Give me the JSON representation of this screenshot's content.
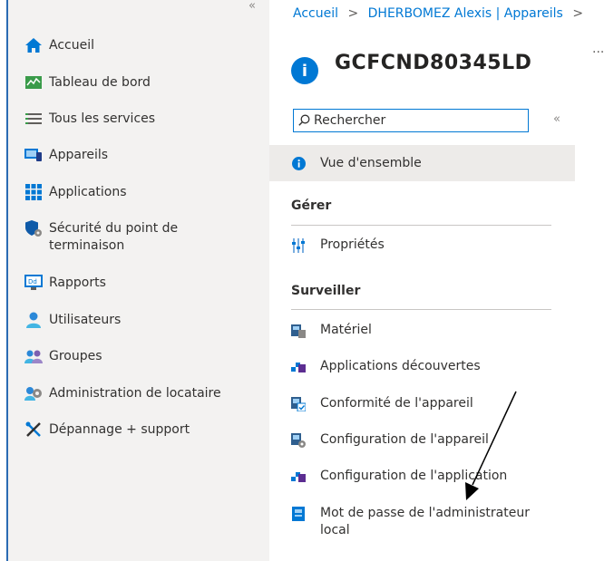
{
  "sidebar": {
    "collapse_glyph": "«",
    "items": [
      {
        "label": "Accueil",
        "icon": "home-icon"
      },
      {
        "label": "Tableau de bord",
        "icon": "dashboard-icon"
      },
      {
        "label": "Tous les services",
        "icon": "list-icon"
      },
      {
        "label": "Appareils",
        "icon": "devices-icon"
      },
      {
        "label": "Applications",
        "icon": "apps-icon"
      },
      {
        "label": "Sécurité du point de terminaison",
        "icon": "shield-icon"
      },
      {
        "label": "Rapports",
        "icon": "reports-icon"
      },
      {
        "label": "Utilisateurs",
        "icon": "user-icon"
      },
      {
        "label": "Groupes",
        "icon": "groups-icon"
      },
      {
        "label": "Administration de locataire",
        "icon": "tenant-admin-icon"
      },
      {
        "label": "Dépannage + support",
        "icon": "troubleshoot-icon"
      }
    ]
  },
  "breadcrumb": {
    "items": [
      "Accueil",
      "DHERBOMEZ Alexis | Appareils"
    ],
    "separator": ">"
  },
  "page": {
    "title": "GCFCND80345LD",
    "more": "···"
  },
  "search": {
    "placeholder": "Rechercher",
    "collapse_glyph": "«"
  },
  "menu": {
    "overview": "Vue d'ensemble",
    "manage_header": "Gérer",
    "manage_items": [
      "Propriétés"
    ],
    "monitor_header": "Surveiller",
    "monitor_items": [
      "Matériel",
      "Applications découvertes",
      "Conformité de l'appareil",
      "Configuration de l'appareil",
      "Configuration de l'application",
      "Mot de passe de l'administrateur local"
    ]
  },
  "colors": {
    "accent": "#0078d4",
    "sidebar_bg": "#f3f2f1",
    "selected_bg": "#edebe9"
  }
}
